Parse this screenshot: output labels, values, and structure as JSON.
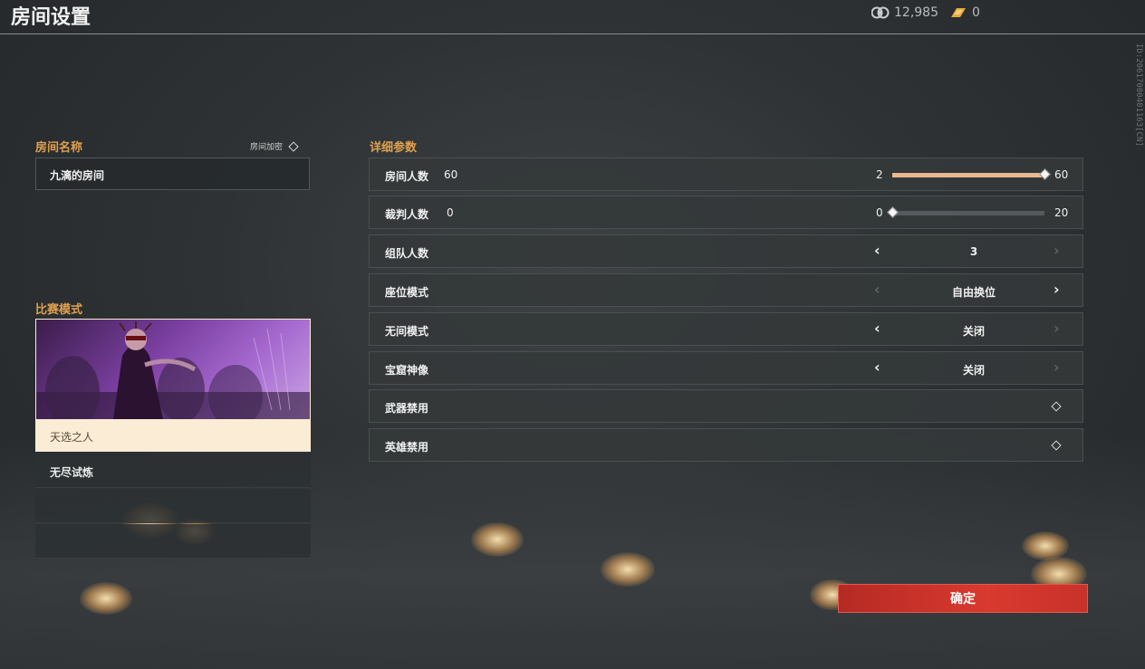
{
  "header": {
    "title": "房间设置",
    "coins": "12,985",
    "tickets": "0",
    "id_text": "ID:20617000401163[CN]"
  },
  "room_name": {
    "section_label": "房间名称",
    "lock_label": "房间加密",
    "value": "九漓的房间"
  },
  "match_mode": {
    "section_label": "比赛模式",
    "selected": "天选之人",
    "items": [
      "无尽试炼",
      "",
      ""
    ]
  },
  "params": {
    "section_label": "详细参数",
    "room_players": {
      "label": "房间人数",
      "value": "60",
      "min": "2",
      "max": "60",
      "fraction": 1.0
    },
    "referees": {
      "label": "裁判人数",
      "value": "0",
      "min": "0",
      "max": "20",
      "fraction": 0.0
    },
    "team_size": {
      "label": "组队人数",
      "value": "3"
    },
    "seat_mode": {
      "label": "座位模式",
      "value": "自由换位"
    },
    "wujian_mode": {
      "label": "无间模式",
      "value": "关闭"
    },
    "statue": {
      "label": "宝窟神像",
      "value": "关闭"
    },
    "weapon_ban": {
      "label": "武器禁用"
    },
    "hero_ban": {
      "label": "英雄禁用"
    }
  },
  "confirm_label": "确定",
  "icons": {
    "coin": "coin-icon",
    "ticket": "ticket-icon",
    "diamond": "diamond-toggle-icon"
  },
  "colors": {
    "accent": "#e0a050",
    "confirm": "#d9392e",
    "slider_fill": "#e8b890"
  }
}
